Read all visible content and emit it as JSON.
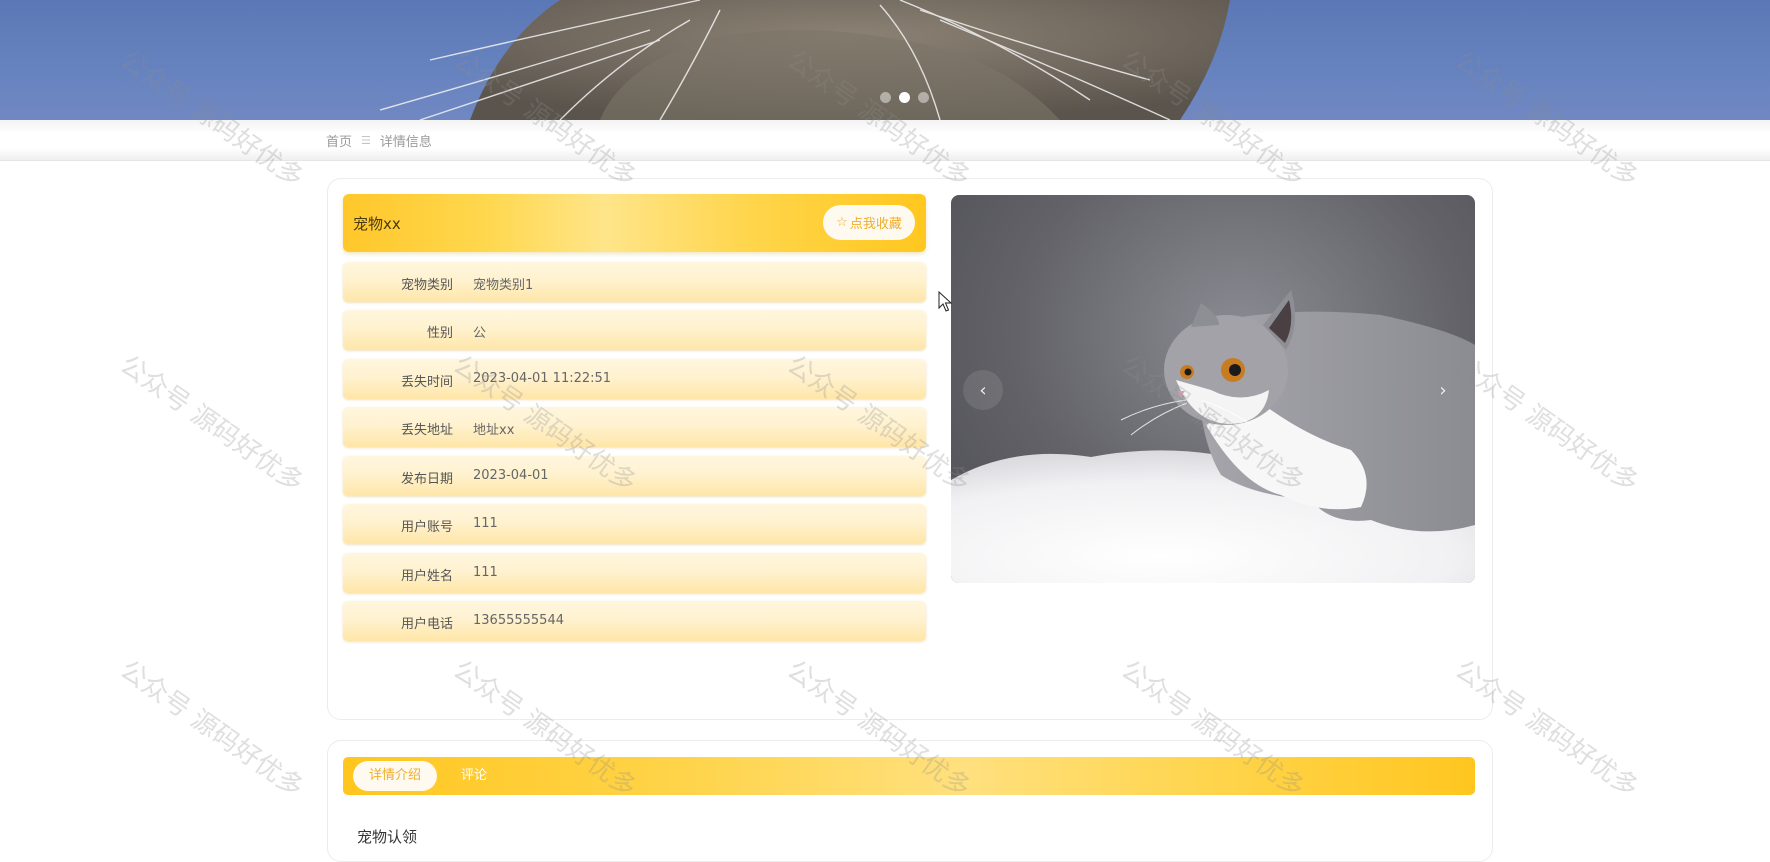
{
  "banner": {
    "slides_total": 3,
    "active_slide": 2
  },
  "breadcrumb": {
    "home": "首页",
    "separator": "☰",
    "current": "详情信息"
  },
  "detail": {
    "title": "宠物xx",
    "favorite_icon": "☆",
    "favorite_label": "点我收藏",
    "fields": [
      {
        "label": "宠物类别",
        "value": "宠物类别1"
      },
      {
        "label": "性别",
        "value": "公"
      },
      {
        "label": "丢失时间",
        "value": "2023-04-01 11:22:51"
      },
      {
        "label": "丢失地址",
        "value": "地址xx"
      },
      {
        "label": "发布日期",
        "value": "2023-04-01"
      },
      {
        "label": "用户账号",
        "value": "111"
      },
      {
        "label": "用户姓名",
        "value": "111"
      },
      {
        "label": "用户电话",
        "value": "13655555544"
      }
    ]
  },
  "carousel": {
    "prev_icon": "‹",
    "next_icon": "›"
  },
  "tabs": {
    "items": [
      {
        "label": "详情介绍",
        "active": true
      },
      {
        "label": "评论",
        "active": false
      }
    ]
  },
  "content": {
    "heading": "宠物认领"
  },
  "watermark_text": "公众号 源码好优多",
  "colors": {
    "accent": "#ffc72a",
    "accent_light": "#ffe58a",
    "favorite_text": "#f0ad2a",
    "banner_bg": "#6783bf"
  }
}
